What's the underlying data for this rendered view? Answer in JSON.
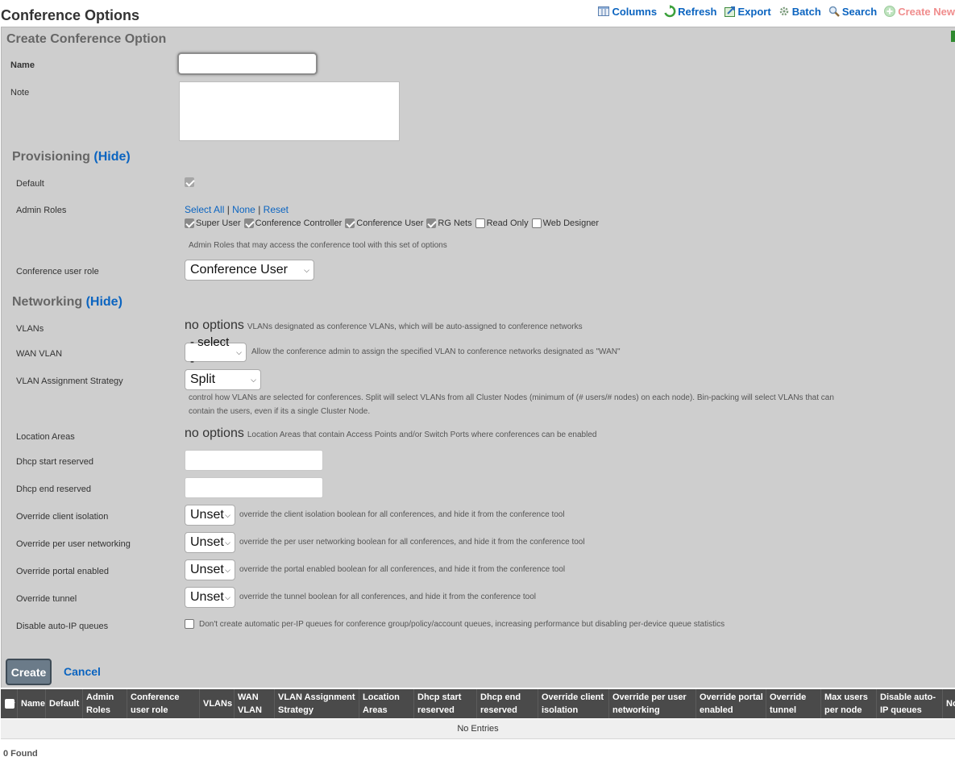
{
  "page": {
    "title": "Conference Options"
  },
  "toolbar": [
    {
      "name": "columns",
      "label": "Columns",
      "icon": "columns-icon"
    },
    {
      "name": "refresh",
      "label": "Refresh",
      "icon": "refresh-icon"
    },
    {
      "name": "export",
      "label": "Export",
      "icon": "export-icon"
    },
    {
      "name": "batch",
      "label": "Batch",
      "icon": "batch-icon"
    },
    {
      "name": "search",
      "label": "Search",
      "icon": "search-icon"
    },
    {
      "name": "create-new",
      "label": "Create New",
      "icon": "plus-circle-icon"
    }
  ],
  "form": {
    "title": "Create Conference Option",
    "name_label": "Name",
    "name_value": "",
    "note_label": "Note",
    "note_value": "",
    "provisioning": {
      "title": "Provisioning",
      "hide": "(Hide)",
      "default_label": "Default",
      "admin_roles_label": "Admin Roles",
      "select_all": "Select All",
      "none": "None",
      "reset": "Reset",
      "roles": [
        {
          "label": "Super User",
          "checked": true
        },
        {
          "label": "Conference Controller",
          "checked": true
        },
        {
          "label": "Conference User",
          "checked": true
        },
        {
          "label": "RG Nets",
          "checked": true
        },
        {
          "label": "Read Only",
          "checked": false
        },
        {
          "label": "Web Designer",
          "checked": false
        }
      ],
      "roles_help": "Admin Roles that may access the conference tool with this set of options",
      "user_role_label": "Conference user role",
      "user_role_value": "Conference User"
    },
    "networking": {
      "title": "Networking",
      "hide": "(Hide)",
      "vlans_label": "VLANs",
      "vlans_value": "no options",
      "vlans_help": "VLANs designated as conference VLANs, which will be auto-assigned to conference networks",
      "wan_label": "WAN VLAN",
      "wan_value": "- select -",
      "wan_help": "Allow the conference admin to assign the specified VLAN to conference networks designated as \"WAN\"",
      "strategy_label": "VLAN Assignment Strategy",
      "strategy_value": "Split",
      "strategy_help_1": "control how VLANs are selected for conferences. Split will select VLANs from all Cluster Nodes (minimum of (# users/# nodes) on each node). Bin-packing will select VLANs that can",
      "strategy_help_2": "contain the users, even if its a single Cluster Node.",
      "areas_label": "Location Areas",
      "areas_value": "no options",
      "areas_help": "Location Areas that contain Access Points and/or Switch Ports where conferences can be enabled",
      "dhcp_start_label": "Dhcp start reserved",
      "dhcp_start_value": "",
      "dhcp_end_label": "Dhcp end reserved",
      "dhcp_end_value": "",
      "iso_label": "Override client isolation",
      "iso_value": "Unset",
      "iso_help": "override the client isolation boolean for all conferences, and hide it from the conference tool",
      "peruser_label": "Override per user networking",
      "peruser_value": "Unset",
      "peruser_help": "override the per user networking boolean for all conferences, and hide it from the conference tool",
      "portal_label": "Override portal enabled",
      "portal_value": "Unset",
      "portal_help": "override the portal enabled boolean for all conferences, and hide it from the conference tool",
      "tunnel_label": "Override tunnel",
      "tunnel_value": "Unset",
      "tunnel_help": "override the tunnel boolean for all conferences, and hide it from the conference tool",
      "autoip_label": "Disable auto-IP queues",
      "autoip_help": "Don't create automatic per-IP queues for conference group/policy/account queues, increasing performance but disabling per-device queue statistics"
    },
    "create_label": "Create",
    "cancel_label": "Cancel"
  },
  "table": {
    "columns": [
      "Name",
      "Default",
      "Admin Roles",
      "Conference user role",
      "VLANs",
      "WAN VLAN",
      "VLAN Assignment Strategy",
      "Location Areas",
      "Dhcp start reserved",
      "Dhcp end reserved",
      "Override client isolation",
      "Override per user networking",
      "Override portal enabled",
      "Override tunnel",
      "Max users per node",
      "Disable auto-IP queues",
      "No"
    ],
    "empty": "No Entries",
    "found": "0 Found"
  }
}
